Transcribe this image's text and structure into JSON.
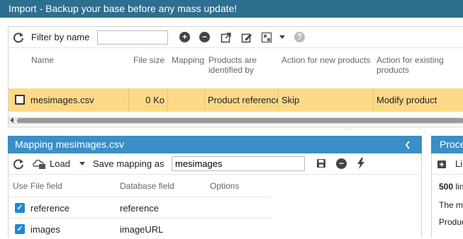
{
  "window": {
    "title": "Import - Backup your base before any mass update!"
  },
  "toolbar": {
    "filter_label": "Filter by name",
    "filter_value": "",
    "icons": [
      "refresh-icon",
      "add-icon",
      "remove-icon",
      "export-icon",
      "edit-icon",
      "grid-icon",
      "chevron-down-icon",
      "help-icon"
    ]
  },
  "grid": {
    "columns": [
      "Name",
      "File size",
      "Mapping",
      "Products are identified by",
      "Action for new products",
      "Action for existing products"
    ],
    "rows": [
      {
        "name": "mesimages.csv",
        "size": "0 Ko",
        "mapping": "",
        "identified_by": "Product reference",
        "new_action": "Skip",
        "existing_action": "Modify product",
        "selected": true
      }
    ]
  },
  "mapping": {
    "title": "Mapping mesimages.csv",
    "load_label": "Load",
    "save_label": "Save mapping as",
    "mapping_name": "mesimages",
    "columns": [
      "Use",
      "File field",
      "Database field",
      "Options"
    ],
    "rows": [
      {
        "file_field": "reference",
        "db_field": "reference",
        "checked": true
      },
      {
        "file_field": "images",
        "db_field": "imageURL",
        "checked": true
      }
    ]
  },
  "process": {
    "title": "Process",
    "line_count": "500",
    "line_word": "lines",
    "line2": "The m",
    "line3": "Produc",
    "button_label": "Li"
  },
  "colors": {
    "titlebar": "#2e6e8e",
    "panel_header": "#3a8fc6",
    "selected_row": "#fbd987",
    "checkbox": "#1e88d6"
  }
}
